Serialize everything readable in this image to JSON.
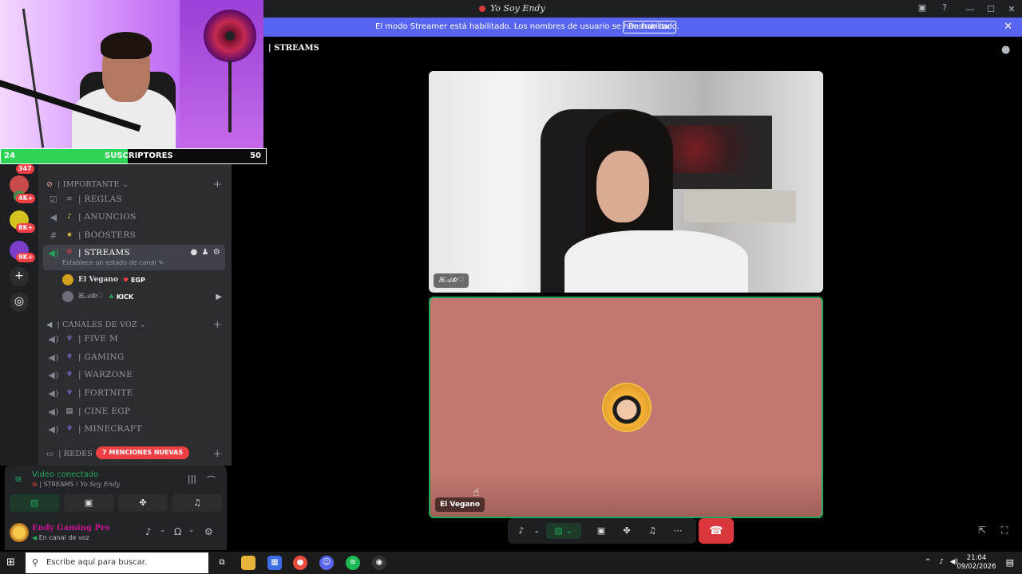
{
  "window": {
    "title": "Yo Soy Endy",
    "controls": [
      "—",
      "☐",
      "✕"
    ]
  },
  "banner": {
    "text": "El modo Streamer está habilitado. Los nombres de usuario se han truncado.",
    "button": "Deshabilitar"
  },
  "overlay": {
    "current": "24",
    "label": "SUSCRIPTORES",
    "goal": "50",
    "progress": 0.48
  },
  "servers": {
    "badges": [
      "347",
      "4K+",
      "8K+",
      "9K+"
    ]
  },
  "sidebar": {
    "categories": [
      {
        "label": "| IMPORTANTE ⌄"
      },
      {
        "label": "| CANALES DE VOZ ⌄"
      },
      {
        "label": "| REDES ⌄"
      }
    ],
    "channels": [
      {
        "label": "| REGLAS"
      },
      {
        "label": "| ANUNCIOS"
      },
      {
        "label": "| BOOSTERS"
      },
      {
        "label": "| STREAMS",
        "sub": "Establece un estado de canal ✎"
      },
      {
        "label": "| FIVE M"
      },
      {
        "label": "| GAMING"
      },
      {
        "label": "| WARZONE"
      },
      {
        "label": "| FORTNITE"
      },
      {
        "label": "| CINE EGP"
      },
      {
        "label": "| MINECRAFT"
      }
    ],
    "voice_users": [
      {
        "name": "El Vegano",
        "tag": "EGP"
      },
      {
        "name": "ꕤ𝒜𝓁𝑒♡",
        "tag": "KICK"
      }
    ],
    "mentions": "7 MENCIONES NUEVAS"
  },
  "voice_panel": {
    "title": "Video conectado",
    "channel": "| STREAMS /",
    "server": "Yo Soy Endy"
  },
  "user_panel": {
    "name": "Endy Gaming Pro",
    "status": "En canal de voz"
  },
  "stage": {
    "title": "| STREAMS",
    "tiles": [
      {
        "label": "ꕤ𝒜𝓁𝑒♡"
      },
      {
        "label": "El Vegano"
      }
    ]
  },
  "taskbar": {
    "search_placeholder": "Escribe aquí para buscar.",
    "time": "21:04",
    "date": "09/02/2026"
  },
  "colors": {
    "blurple": "#5865f2",
    "green": "#23a55a",
    "red": "#da373c",
    "tile_bg": "#c27870"
  }
}
